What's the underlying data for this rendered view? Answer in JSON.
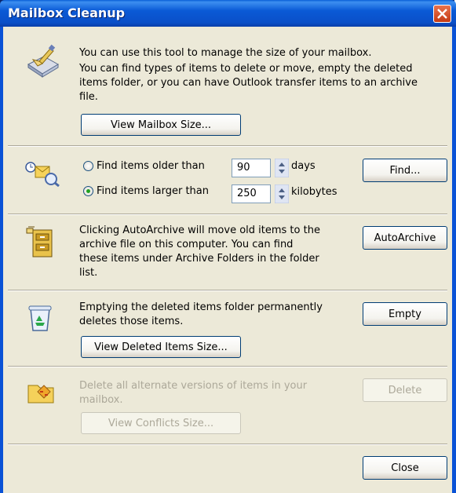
{
  "window": {
    "title": "Mailbox Cleanup"
  },
  "intro": {
    "text_lines": [
      "You can use this tool to manage the size of your mailbox.",
      "You can find types of items to delete or move, empty the deleted",
      "items folder, or you can have Outlook transfer items to an archive",
      "file."
    ],
    "view_size_label": "View Mailbox Size..."
  },
  "find": {
    "older_label": "Find items older than",
    "older_value": "90",
    "older_unit": "days",
    "larger_label": "Find items larger than",
    "larger_value": "250",
    "larger_unit": "kilobytes",
    "selected": "larger",
    "find_button": "Find..."
  },
  "autoarchive": {
    "text_lines": [
      "Clicking AutoArchive will move old items to the",
      "archive file on this computer.  You can find",
      "these items under Archive Folders in the folder",
      "list."
    ],
    "button": "AutoArchive"
  },
  "deleted": {
    "text_lines": [
      "Emptying the deleted items folder permanently",
      "deletes those items."
    ],
    "empty_button": "Empty",
    "view_size_label": "View Deleted Items Size..."
  },
  "conflicts": {
    "text_lines": [
      "Delete all alternate versions of items in your",
      "mailbox."
    ],
    "delete_button": "Delete",
    "view_size_label": "View Conflicts Size..."
  },
  "footer": {
    "close_button": "Close"
  },
  "colors": {
    "title_bar": "#0a5ad6",
    "dialog_bg": "#ece9d8",
    "disabled_text": "#aca899",
    "close_red": "#c43a14"
  }
}
